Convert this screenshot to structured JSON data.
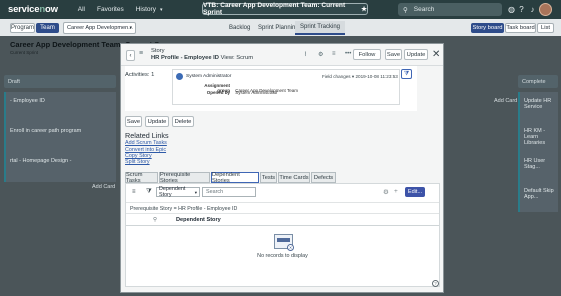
{
  "topnav": {
    "logo": "servicenow",
    "links": [
      "All",
      "Favorites",
      "History"
    ],
    "workspace_title": "VTB: Career App Development Team: Current Sprint",
    "search_placeholder": "Search",
    "icons": [
      "search-icon",
      "globe-icon",
      "help-icon",
      "bell-icon"
    ]
  },
  "board": {
    "program_label": "Program",
    "team_label": "Team",
    "team_select": "Career App Developmen...",
    "tabs": [
      "Backlog",
      "Sprint Planning",
      "Sprint Tracking"
    ],
    "active_tab": "Sprint Tracking",
    "views": [
      "Story board",
      "Task board",
      "List"
    ],
    "active_view": "Story board",
    "title": "Career App Development Team: Current S",
    "subtitle": "Current Sprint",
    "columns": [
      {
        "name": "Draft",
        "cards": [
          "- Employee ID",
          "Enroll in career path program",
          "rtal - Homepage Design -"
        ]
      },
      {
        "name": "Complete",
        "cards": [
          "Update HR Service",
          "HR KM - Learn Libraries",
          "HR User Stag...",
          "Default Skip App..."
        ]
      }
    ],
    "add_card": "Add Card"
  },
  "modal": {
    "form_type": "Story",
    "record": "HR Profile - Employee ID",
    "view_label": "View: Scrum",
    "header_buttons": {
      "follow": "Follow",
      "save": "Save",
      "update": "Update"
    },
    "activities_label": "Activities: 1",
    "activity": {
      "user": "System Administrator",
      "type": "Field changes",
      "timestamp": "2019-10-08 11:23:53",
      "fields": [
        {
          "key": "Assignment group",
          "value": "Career App Development Team"
        },
        {
          "key": "Opened by",
          "value": "System Administrator"
        }
      ]
    },
    "form_buttons": {
      "save": "Save",
      "update": "Update",
      "delete": "Delete"
    },
    "related_links_title": "Related Links",
    "related_links": [
      "Add Scrum Tasks",
      "Convert into Epic",
      "Copy Story",
      "Split Story"
    ],
    "related_tabs": [
      "Scrum Tasks",
      "Prerequisite Stories",
      "Dependent Stories",
      "Tests",
      "Time Cards",
      "Defects"
    ],
    "active_related_tab": "Dependent Stories",
    "list": {
      "search_field": "Dependent Story",
      "search_placeholder": "Search",
      "edit_label": "Edit...",
      "breadcrumb": "Prerequisite Story = HR Profile - Employee ID",
      "column": "Dependent Story",
      "empty_message": "No records to display"
    }
  }
}
